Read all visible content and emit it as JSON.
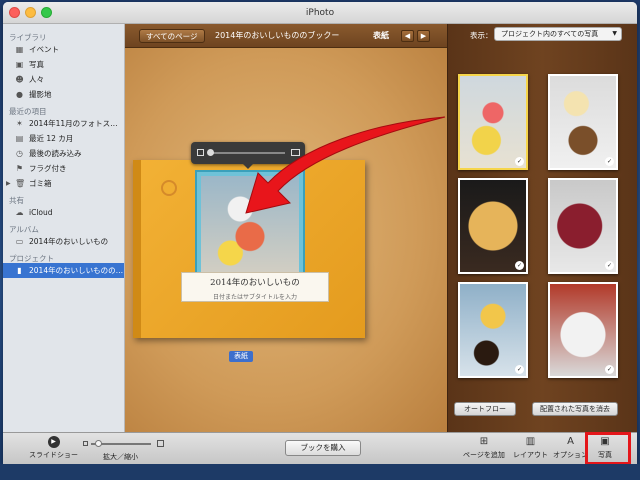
{
  "window": {
    "title": "iPhoto"
  },
  "sidebar": {
    "sections": [
      {
        "header": "ライブラリ",
        "items": [
          {
            "label": "イベント",
            "icon": "events-icon"
          },
          {
            "label": "写真",
            "icon": "photos-icon"
          },
          {
            "label": "人々",
            "icon": "faces-icon"
          },
          {
            "label": "撮影地",
            "icon": "places-icon"
          }
        ]
      },
      {
        "header": "最近の項目",
        "items": [
          {
            "label": "2014年11月のフォトス…",
            "icon": "photostream-icon"
          },
          {
            "label": "最近 12 カ月",
            "icon": "calendar-icon"
          },
          {
            "label": "最後の読み込み",
            "icon": "last-import-icon"
          },
          {
            "label": "フラグ付き",
            "icon": "flag-icon"
          },
          {
            "label": "ゴミ箱",
            "icon": "trash-icon"
          }
        ]
      },
      {
        "header": "共有",
        "items": [
          {
            "label": "iCloud",
            "icon": "cloud-icon"
          }
        ]
      },
      {
        "header": "アルバム",
        "items": [
          {
            "label": "2014年のおいしいもの",
            "icon": "album-icon"
          }
        ]
      },
      {
        "header": "プロジェクト",
        "items": [
          {
            "label": "2014年のおいしいものの…",
            "icon": "book-icon",
            "selected": true
          }
        ]
      }
    ]
  },
  "center": {
    "all_pages": "すべてのページ",
    "book_title": "2014年のおいしいもののブックー",
    "page_label": "表紙",
    "cover_title": "2014年のおいしいもの",
    "cover_subtitle": "日付またはサブタイトルを入力",
    "cover_tag": "表紙"
  },
  "right": {
    "view_label": "表示：",
    "view_value": "プロジェクト内のすべての写真",
    "autoflow": "オートフロー",
    "clear_placed": "配置された写真を消去",
    "thumbnails": [
      {
        "name": "dessert-plate",
        "checked": true,
        "selected": true
      },
      {
        "name": "burger-soup",
        "checked": true
      },
      {
        "name": "pizza",
        "checked": true
      },
      {
        "name": "grapes",
        "checked": true
      },
      {
        "name": "omelette-coffee",
        "checked": true
      },
      {
        "name": "curry-rice",
        "checked": true
      }
    ]
  },
  "toolbar": {
    "slideshow": "スライドショー",
    "zoom": "拡大／縮小",
    "buy_book": "ブックを購入",
    "add_page": "ページを追加",
    "layout": "レイアウト",
    "options": "オプション",
    "photos": "写真"
  },
  "colors": {
    "selection": "#3874d1",
    "highlight": "#e4161a",
    "arrow": "#e8151b"
  }
}
